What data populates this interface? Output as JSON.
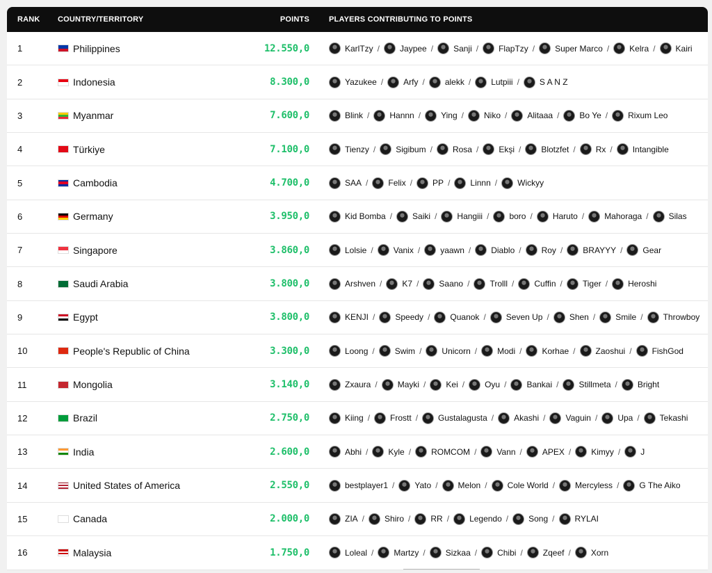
{
  "header": {
    "rank": "RANK",
    "country": "COUNTRY/TERRITORY",
    "points": "POINTS",
    "players": "PLAYERS CONTRIBUTING TO POINTS"
  },
  "colors": {
    "points": "#1fbf6a",
    "header_bg": "#0e0e0e"
  },
  "rows": [
    {
      "rank": "1",
      "country": "Philippines",
      "flag": "philippines-flag",
      "points": "12.550,0",
      "players": [
        "KarlTzy",
        "Jaypee",
        "Sanji",
        "FlapTzy",
        "Super Marco",
        "Kelra",
        "Kairi"
      ]
    },
    {
      "rank": "2",
      "country": "Indonesia",
      "flag": "indonesia-flag",
      "points": "8.300,0",
      "players": [
        "Yazukee",
        "Arfy",
        "alekk",
        "Lutpiii",
        "S A N Z"
      ]
    },
    {
      "rank": "3",
      "country": "Myanmar",
      "flag": "myanmar-flag",
      "points": "7.600,0",
      "players": [
        "Blink",
        "Hannn",
        "Ying",
        "Niko",
        "Alitaaa",
        "Bo Ye",
        "Rixum Leo"
      ]
    },
    {
      "rank": "4",
      "country": "Türkiye",
      "flag": "turkiye-flag",
      "points": "7.100,0",
      "players": [
        "Tienzy",
        "Sigibum",
        "Rosa",
        "Ekşi",
        "Blotzfet",
        "Rx",
        "Intangible"
      ]
    },
    {
      "rank": "5",
      "country": "Cambodia",
      "flag": "cambodia-flag",
      "points": "4.700,0",
      "players": [
        "SAA",
        "Felix",
        "PP",
        "Linnn",
        "Wickyy"
      ]
    },
    {
      "rank": "6",
      "country": "Germany",
      "flag": "germany-flag",
      "points": "3.950,0",
      "players": [
        "Kid Bomba",
        "Saiki",
        "Hangiii",
        "boro",
        "Haruto",
        "Mahoraga",
        "Silas"
      ]
    },
    {
      "rank": "7",
      "country": "Singapore",
      "flag": "singapore-flag",
      "points": "3.860,0",
      "players": [
        "Lolsie",
        "Vanix",
        "yaawn",
        "Diablo",
        "Roy",
        "BRAYYY",
        "Gear"
      ]
    },
    {
      "rank": "8",
      "country": "Saudi Arabia",
      "flag": "saudi-arabia-flag",
      "points": "3.800,0",
      "players": [
        "Arshven",
        "K7",
        "Saano",
        "Trolll",
        "Cuffin",
        "Tiger",
        "Heroshi"
      ]
    },
    {
      "rank": "9",
      "country": "Egypt",
      "flag": "egypt-flag",
      "points": "3.800,0",
      "players": [
        "KENJI",
        "Speedy",
        "Quanok",
        "Seven Up",
        "Shen",
        "Smile",
        "Throwboy"
      ]
    },
    {
      "rank": "10",
      "country": "People's Republic of China",
      "flag": "china-flag",
      "points": "3.300,0",
      "players": [
        "Loong",
        "Swim",
        "Unicorn",
        "Modi",
        "Korhae",
        "Zaoshui",
        "FishGod"
      ]
    },
    {
      "rank": "11",
      "country": "Mongolia",
      "flag": "mongolia-flag",
      "points": "3.140,0",
      "players": [
        "Zxaura",
        "Mayki",
        "Kei",
        "Oyu",
        "Bankai",
        "Stillmeta",
        "Bright"
      ]
    },
    {
      "rank": "12",
      "country": "Brazil",
      "flag": "brazil-flag",
      "points": "2.750,0",
      "players": [
        "Kiing",
        "Frostt",
        "Gustalagusta",
        "Akashi",
        "Vaguin",
        "Upa",
        "Tekashi"
      ]
    },
    {
      "rank": "13",
      "country": "India",
      "flag": "india-flag",
      "points": "2.600,0",
      "players": [
        "Abhi",
        "Kyle",
        "ROMCOM",
        "Vann",
        "APEX",
        "Kimyy",
        "J"
      ]
    },
    {
      "rank": "14",
      "country": "United States of America",
      "flag": "usa-flag",
      "points": "2.550,0",
      "players": [
        "bestplayer1",
        "Yato",
        "Melon",
        "Cole World",
        "Mercyless",
        "G The Aiko"
      ]
    },
    {
      "rank": "15",
      "country": "Canada",
      "flag": "canada-flag",
      "points": "2.000,0",
      "players": [
        "ZIA",
        "Shiro",
        "RR",
        "Legendo",
        "Song",
        "RYLAI"
      ]
    },
    {
      "rank": "16",
      "country": "Malaysia",
      "flag": "malaysia-flag",
      "points": "1.750,0",
      "players": [
        "Loleal",
        "Martzy",
        "Sizkaa",
        "Chibi",
        "Zqeef",
        "Xorn"
      ]
    }
  ]
}
